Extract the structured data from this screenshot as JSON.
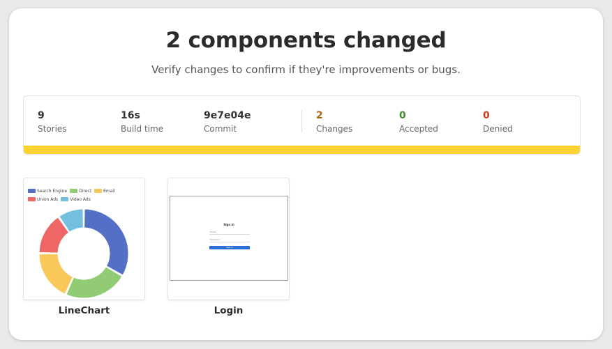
{
  "header": {
    "title": "2 components changed",
    "subtitle": "Verify changes to confirm if they're improvements or bugs."
  },
  "stats": [
    {
      "value": "9",
      "label": "Stories",
      "color": "#333333"
    },
    {
      "value": "16s",
      "label": "Build time",
      "color": "#333333"
    },
    {
      "value": "9e7e04e",
      "label": "Commit",
      "color": "#333333"
    },
    {
      "value": "2",
      "label": "Changes",
      "color": "#a4660f"
    },
    {
      "value": "0",
      "label": "Accepted",
      "color": "#3c8a2e"
    },
    {
      "value": "0",
      "label": "Denied",
      "color": "#d43c16"
    }
  ],
  "progress": {
    "color": "#fcd22f",
    "fraction": 1.0
  },
  "components": [
    {
      "name": "LineChart"
    },
    {
      "name": "Login"
    }
  ],
  "chart_data": {
    "type": "pie",
    "variant": "donut",
    "categories": [
      "Search Engine",
      "Direct",
      "Email",
      "Union Ads",
      "Video Ads"
    ],
    "values": [
      1048,
      735,
      580,
      484,
      300
    ],
    "colors": [
      "#5470c6",
      "#91cc75",
      "#fac858",
      "#ee6666",
      "#73c0de"
    ],
    "legend": "top-left"
  },
  "login_preview": {
    "title": "Sign in",
    "username_placeholder": "Email",
    "password_placeholder": "Password",
    "button_label": "Sign in"
  }
}
